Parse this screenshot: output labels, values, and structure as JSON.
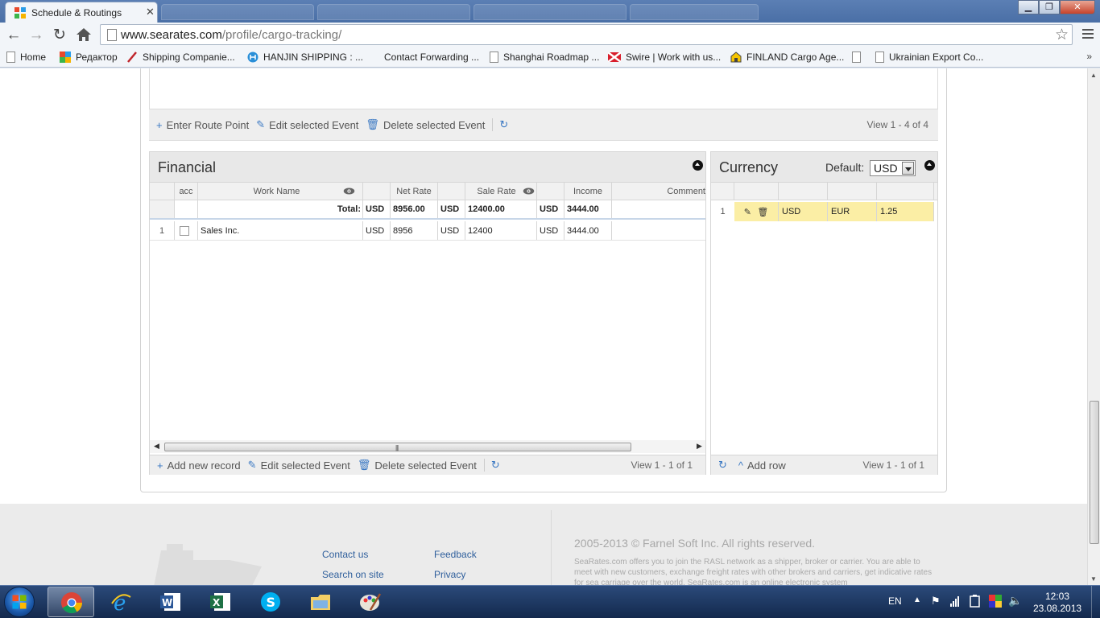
{
  "browser": {
    "active_tab_title": "Schedule & Routings",
    "url_host": "www.searates.com",
    "url_path": "/profile/cargo-tracking/",
    "bookmarks": [
      {
        "label": "Home",
        "icon": "page-icon"
      },
      {
        "label": "Редактор",
        "icon": "editor-icon"
      },
      {
        "label": "Shipping Companie...",
        "icon": "page-icon"
      },
      {
        "label": "HANJIN SHIPPING : ...",
        "icon": "hanjin-icon"
      },
      {
        "label": "Contact Forwarding ...",
        "icon": "none"
      },
      {
        "label": "Shanghai Roadmap ...",
        "icon": "page-icon"
      },
      {
        "label": "Swire | Work with us...",
        "icon": "swire-flag-icon"
      },
      {
        "label": "FINLAND Cargo Age...",
        "icon": "house-icon"
      },
      {
        "label": "Ukrainian Export Co...",
        "icon": "page-icon"
      }
    ]
  },
  "route": {
    "enter_point": "Enter Route Point",
    "edit_event": "Edit selected Event",
    "delete_event": "Delete selected Event",
    "view_info": "View 1 - 4 of 4"
  },
  "financial": {
    "title": "Financial",
    "columns": {
      "acc": "acc",
      "work_name": "Work Name",
      "net_rate": "Net Rate",
      "sale_rate": "Sale Rate",
      "income": "Income",
      "comment": "Comment"
    },
    "total": {
      "label": "Total:",
      "net_currency": "USD",
      "net_value": "8956.00",
      "sale_currency": "USD",
      "sale_value": "12400.00",
      "income_currency": "USD",
      "income_value": "3444.00"
    },
    "rows": [
      {
        "num": "1",
        "work_name": "Sales Inc.",
        "net_currency": "USD",
        "net_value": "8956",
        "sale_currency": "USD",
        "sale_value": "12400",
        "income_currency": "USD",
        "income_value": "3444.00"
      }
    ],
    "add_record": "Add new record",
    "edit_event": "Edit selected Event",
    "delete_event": "Delete selected Event",
    "view_info": "View 1 - 1 of 1"
  },
  "currency": {
    "title": "Currency",
    "default_label": "Default:",
    "default_value": "USD",
    "rows": [
      {
        "num": "1",
        "from": "USD",
        "to": "EUR",
        "rate": "1.25"
      }
    ],
    "add_row": "Add row",
    "view_info": "View 1 - 1 of 1"
  },
  "footer": {
    "contact": "Contact us",
    "feedback": "Feedback",
    "search": "Search on site",
    "privacy": "Privacy",
    "copyright": "2005-2013 © Farnel Soft Inc. All rights reserved.",
    "about": "SeaRates.com offers you to join the RASL network as a shipper, broker or carrier. You are able to meet with new customers, exchange freight rates with other brokers and carriers, get indicative rates for sea carriage over the world. SeaRates.com is an online electronic system"
  },
  "taskbar": {
    "language": "EN",
    "time": "12:03",
    "date": "23.08.2013"
  },
  "colors": {
    "accent_link": "#2f5f9c",
    "icon_blue": "#3a78c3",
    "selected_row": "#fbeea5"
  }
}
